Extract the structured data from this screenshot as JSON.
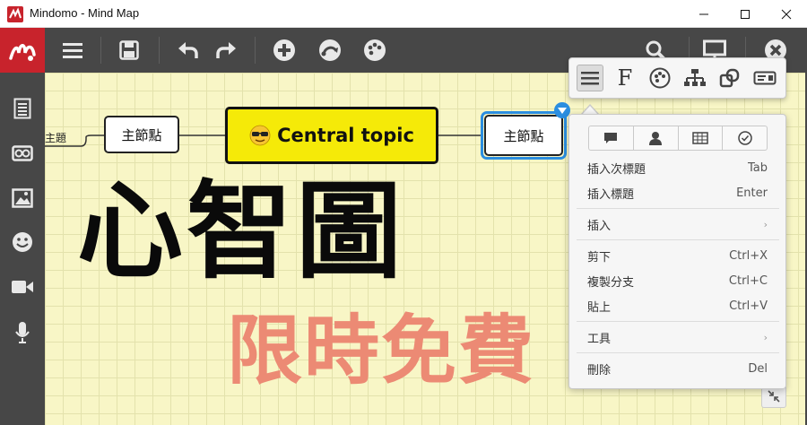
{
  "window": {
    "title": "Mindomo - Mind Map",
    "controls": [
      "minimize",
      "maximize",
      "close"
    ]
  },
  "toolbar": {
    "left_buttons": [
      "menu-icon",
      "save-icon",
      "undo-icon",
      "redo-icon",
      "add-topic-icon",
      "relationship-icon",
      "theme-palette-icon"
    ],
    "right_buttons": [
      "search-icon",
      "presentation-icon",
      "close-map-icon"
    ]
  },
  "sidebar": {
    "items": [
      "notes-icon",
      "link-icon",
      "image-icon",
      "emoji-icon",
      "video-icon",
      "microphone-icon"
    ]
  },
  "canvas": {
    "partial_label": "主題",
    "left_node": "主節點",
    "central_topic": "Central topic",
    "right_node": "主節點",
    "overlay_title": "心智圖",
    "overlay_subtitle": "限時免費"
  },
  "format_bar": {
    "buttons": [
      "list-style-icon",
      "font-icon",
      "color-palette-icon",
      "structure-icon",
      "shape-icon",
      "label-icon"
    ],
    "font_glyph": "F",
    "active_index": 0
  },
  "context_menu": {
    "top_tabs": [
      "comment-icon",
      "assign-icon",
      "table-icon",
      "task-icon"
    ],
    "items": [
      {
        "label": "插入次標題",
        "shortcut": "Tab"
      },
      {
        "label": "插入標題",
        "shortcut": "Enter"
      },
      {
        "label": "插入",
        "shortcut": "›"
      },
      {
        "label": "剪下",
        "shortcut": "Ctrl+X"
      },
      {
        "label": "複製分支",
        "shortcut": "Ctrl+C"
      },
      {
        "label": "貼上",
        "shortcut": "Ctrl+V"
      },
      {
        "label": "工具",
        "shortcut": "›"
      },
      {
        "label": "刪除",
        "shortcut": "Del"
      }
    ]
  },
  "colors": {
    "toolbar_bg": "#474747",
    "brand_red": "#c8232c",
    "canvas_bg": "#f8f6c6",
    "central_fill": "#f5ea08",
    "selection_blue": "#2b8ee0",
    "subtitle_salmon": "#ec8a74"
  }
}
